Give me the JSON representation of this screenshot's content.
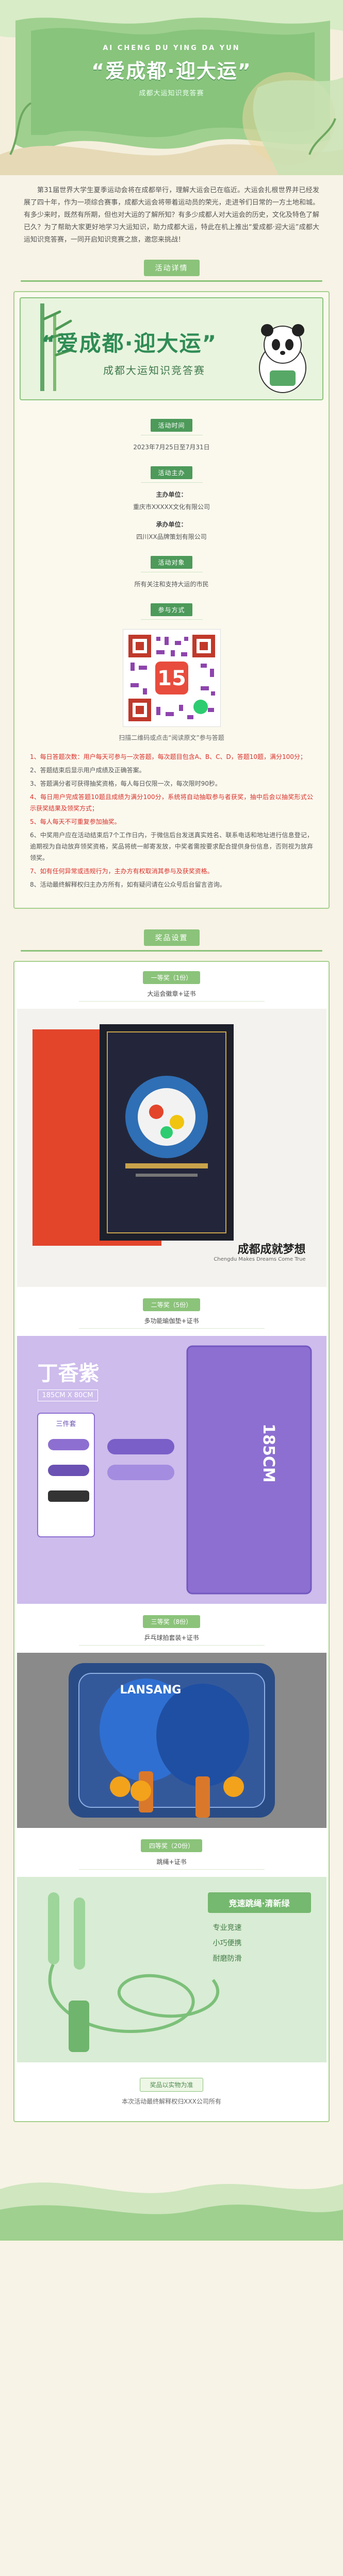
{
  "hero": {
    "pinyin": "AI CHENG DU YING DA YUN",
    "title": "“爱成都·迎大运”",
    "subtitle": "成都大运知识竞答赛"
  },
  "intro": {
    "text": "第31届世界大学生夏季运动会将在成都举行，理解大运会已在临近。大运会扎根世界并已经发展了四十年，作为一项综合赛事，成都大运会将带着运动员的荣光，走进爷们日常的一方土地和城。有多少来时，既然有所期，但也对大运的了解所知？有多少成都人对大运会的历史，文化及特色了解已久？为了帮助大家更好地学习大运知识，助力成都大运，特此在机上推出“爱成都·迎大运”成都大运知识竞答赛，一同开启知识竞赛之旅，邀您来挑战！"
  },
  "sections": {
    "details": "活动详情",
    "prizes": "奖品设置"
  },
  "banner": {
    "title": "“爱成都·迎大运”",
    "subtitle": "成都大运知识竞答赛"
  },
  "blocks": {
    "time_tag": "活动时间",
    "time_value": "2023年7月25日至7月31日",
    "org_tag": "活动主办",
    "org_host_label": "主办单位：",
    "org_host": "重庆市XXXXX文化有限公司",
    "org_exec_label": "承办单位：",
    "org_exec": "四川XX品牌策划有限公司",
    "target_tag": "活动对象",
    "target_value": "所有关注和支持大运的市民",
    "join_tag": "参与方式",
    "qr_hint": "扫描二维码或点击“阅读原文”参与答题"
  },
  "rules": {
    "items": [
      {
        "text": "1、每日答题次数：用户每天可参与一次答题，每次题目包含A、B、C、D，答题10题，满分100分；",
        "red": true
      },
      {
        "text": "2、答题结束后显示用户成绩及正确答案。",
        "red": false
      },
      {
        "text": "3、答题满分者可获得抽奖资格，每人每日仅限一次，每次限时90秒。",
        "red": false
      },
      {
        "text": "4、每日用户完成答题10题且成绩为满分100分，系统将自动抽取参与者获奖，抽中后会以抽奖形式公示获奖结果及领奖方式；",
        "red": true
      },
      {
        "text": "5、每人每天不可重复参加抽奖。",
        "red": true
      },
      {
        "text": "6、中奖用户应在活动结束后7个工作日内，于微信后台发送真实姓名、联系电话和地址进行信息登记，逾期视为自动放弃领奖资格，奖品将统一邮寄发放，中奖者需按要求配合提供身份信息，否则视为放弃领奖。",
        "red": false
      },
      {
        "text": "7、如有任何异常或违规行为，主办方有权取消其参与及获奖资格。",
        "red": true
      },
      {
        "text": "8、活动最终解释权归主办方所有，如有疑问请在公众号后台留言咨询。",
        "red": false
      }
    ]
  },
  "prizes": [
    {
      "tag": "一等奖（1份）",
      "name": "大运会徽章+证书"
    },
    {
      "tag": "二等奖（5份）",
      "name": "多功能瑜伽垫+证书"
    },
    {
      "tag": "三等奖（8份）",
      "name": "乒乓球拍套装+证书"
    },
    {
      "tag": "四等奖（20份）",
      "name": "跳绳+证书"
    }
  ],
  "prize_visuals": {
    "p1_brand": "成都成就梦想",
    "p1_brand_sub": "Chengdu Makes Dreams Come True",
    "p2_title": "丁香紫",
    "p2_size": "185CM X 80CM",
    "p2_length": "185CM",
    "p2_kit": "三件套",
    "p3_brand": "LANSANG",
    "p4_title": "竞速跳绳·清新绿",
    "p4_features": [
      "专业竞速",
      "小巧便携",
      "耐磨防滑"
    ]
  },
  "footer": {
    "pill": "奖品以实物为准",
    "text": "本次活动最终解释权归XXX公司所有"
  },
  "colors": {
    "green": "#8bc37a",
    "dark_green": "#4d9a5a",
    "cream": "#f7f3e6",
    "red_text": "#d9302a"
  }
}
